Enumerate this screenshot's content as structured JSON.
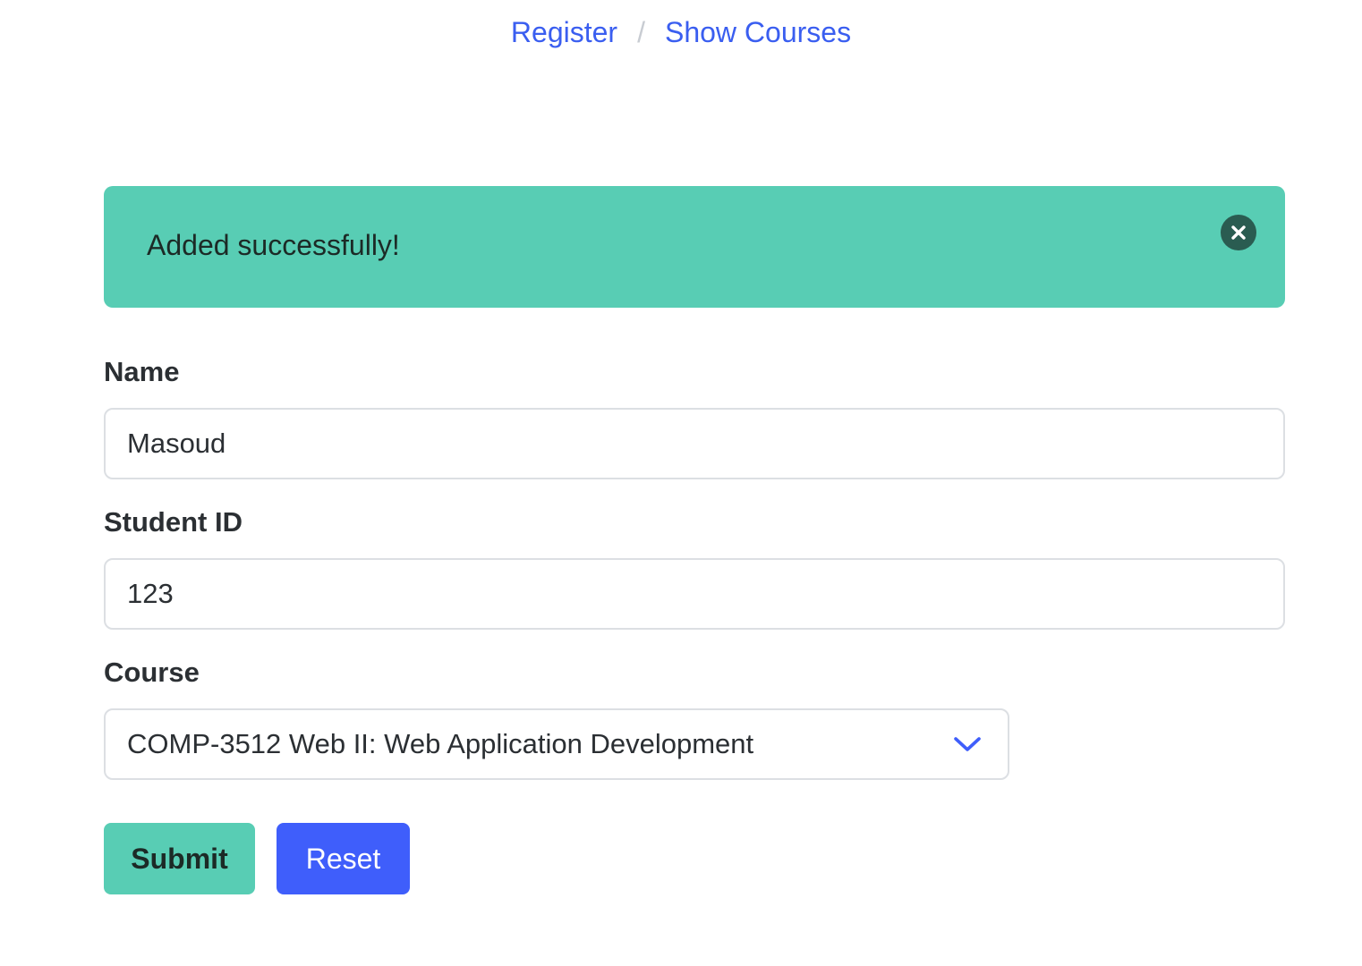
{
  "nav": {
    "register_label": "Register",
    "separator": "/",
    "show_courses_label": "Show Courses",
    "link_color": "#3a5ef0"
  },
  "notification": {
    "message": "Added successfully!",
    "close_icon": "close-icon",
    "color": "#58cdb4"
  },
  "form": {
    "name_label": "Name",
    "name_value": "Masoud",
    "student_id_label": "Student ID",
    "student_id_value": "123",
    "course_label": "Course",
    "course_selected": "COMP-3512 Web II: Web Application Development",
    "course_icon": "chevron-down-icon"
  },
  "buttons": {
    "submit_label": "Submit",
    "submit_color": "#58cdb4",
    "reset_label": "Reset",
    "reset_color": "#3f5efb"
  }
}
